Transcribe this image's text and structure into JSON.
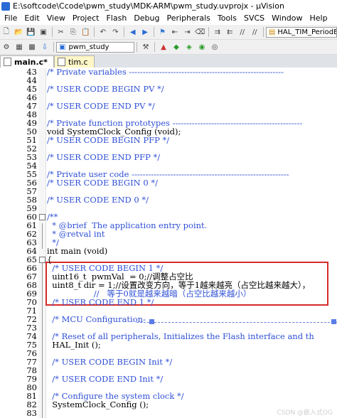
{
  "window": {
    "title": "E:\\softcode\\Ccode\\pwm_study\\MDK-ARM\\pwm_study.uvprojx - µVision"
  },
  "menu": [
    "File",
    "Edit",
    "View",
    "Project",
    "Flash",
    "Debug",
    "Peripherals",
    "Tools",
    "SVCS",
    "Window",
    "Help"
  ],
  "toolbar": {
    "find_combo": "HAL_TIM_PeriodElaps",
    "target_combo": "pwm_study"
  },
  "tabs": [
    {
      "label": "main.c*"
    },
    {
      "label": "tim.c"
    }
  ],
  "editor": {
    "lines": [
      {
        "n": "43",
        "text": "/* Private variables --------------------------------------------------------",
        "fold": false
      },
      {
        "n": "44",
        "text": "",
        "fold": false
      },
      {
        "n": "45",
        "text": "/* USER CODE BEGIN PV */",
        "fold": false
      },
      {
        "n": "46",
        "text": "",
        "fold": false
      },
      {
        "n": "47",
        "text": "/* USER CODE END PV */",
        "fold": false
      },
      {
        "n": "48",
        "text": "",
        "fold": false
      },
      {
        "n": "49",
        "text": "/* Private function prototypes -----------------------------------------------",
        "fold": false
      },
      {
        "n": "50",
        "text": "void SystemClock_Config (void);",
        "fold": false
      },
      {
        "n": "51",
        "text": "/* USER CODE BEGIN PFP */",
        "fold": false
      },
      {
        "n": "52",
        "text": "",
        "fold": false
      },
      {
        "n": "53",
        "text": "/* USER CODE END PFP */",
        "fold": false
      },
      {
        "n": "54",
        "text": "",
        "fold": false
      },
      {
        "n": "55",
        "text": "/* Private user code ---------------------------------------------------------",
        "fold": false
      },
      {
        "n": "56",
        "text": "/* USER CODE BEGIN 0 */",
        "fold": false
      },
      {
        "n": "57",
        "text": "",
        "fold": false
      },
      {
        "n": "58",
        "text": "/* USER CODE END 0 */",
        "fold": false
      },
      {
        "n": "59",
        "text": "",
        "fold": false
      },
      {
        "n": "60",
        "text": "/**",
        "fold": true
      },
      {
        "n": "61",
        "text": "  * @brief  The application entry point.",
        "fold": false
      },
      {
        "n": "62",
        "text": "  * @retval int",
        "fold": false
      },
      {
        "n": "63",
        "text": "  */",
        "fold": false
      },
      {
        "n": "64",
        "text": "int main (void)",
        "fold": false
      },
      {
        "n": "65",
        "text": "{",
        "fold": true
      },
      {
        "n": "66",
        "text": "  /* USER CODE BEGIN 1 */",
        "fold": false
      },
      {
        "n": "67",
        "text": "  uint16_t  pwmVal  = 0;//调整占空比",
        "fold": false
      },
      {
        "n": "68",
        "text": "  uint8_t dir = 1;//设置改变方向，等于1越来越亮（占空比越来越大），",
        "fold": false
      },
      {
        "n": "69",
        "text": "                  //   等于0就是越来越暗（占空比越来越小）",
        "fold": false
      },
      {
        "n": "70",
        "text": "  /* USER CODE END 1 */",
        "fold": false
      },
      {
        "n": "71",
        "text": "",
        "fold": false
      },
      {
        "n": "72",
        "text": "  /* MCU Configuration-",
        "fold": false
      },
      {
        "n": "73",
        "text": "",
        "fold": false
      },
      {
        "n": "74",
        "text": "  /* Reset of all peripherals, Initializes the Flash interface and th",
        "fold": false
      },
      {
        "n": "75",
        "text": "  HAL_Init ();",
        "fold": false
      },
      {
        "n": "76",
        "text": "",
        "fold": false
      },
      {
        "n": "77",
        "text": "  /* USER CODE BEGIN Init */",
        "fold": false
      },
      {
        "n": "78",
        "text": "",
        "fold": false
      },
      {
        "n": "79",
        "text": "  /* USER CODE END Init */",
        "fold": false
      },
      {
        "n": "80",
        "text": "",
        "fold": false
      },
      {
        "n": "81",
        "text": "  /* Configure the system clock */",
        "fold": false
      },
      {
        "n": "82",
        "text": "  SystemClock_Config ();",
        "fold": false
      },
      {
        "n": "83",
        "text": "",
        "fold": false
      }
    ]
  },
  "watermark": "CSDN @嵌入式OG",
  "colors": {
    "comment": "#2e4fd6",
    "code": "#000000",
    "highlight_box": "#d62b2b"
  }
}
